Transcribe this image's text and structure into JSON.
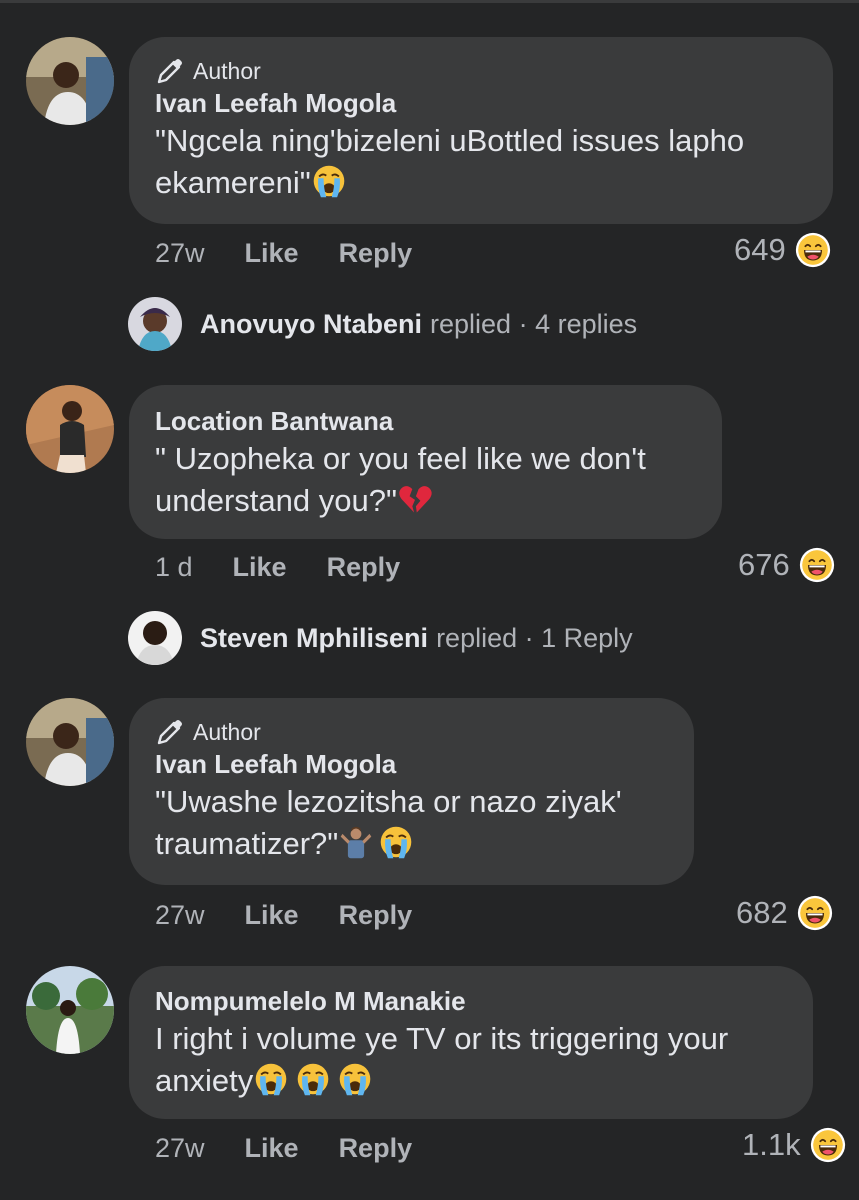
{
  "comments": [
    {
      "is_author": true,
      "author_badge": "Author",
      "name": "Ivan Leefah Mogola",
      "text_lines": [
        "\"Ngcela ning'bizeleni uBottled issues lapho",
        "ekamereni\""
      ],
      "emoji_after": [
        "loudly-crying-face"
      ],
      "time": "27w",
      "like_label": "Like",
      "reply_label": "Reply",
      "reaction_count": "649",
      "reaction_icon": "laughing-face-icon"
    },
    {
      "is_author": false,
      "name": "Location Bantwana",
      "text_lines": [
        "\" Uzopheka or you feel like we don't",
        "understand you?\""
      ],
      "emoji_after": [
        "broken-heart"
      ],
      "time": "1 d",
      "like_label": "Like",
      "reply_label": "Reply",
      "reaction_count": "676",
      "reaction_icon": "laughing-face-icon"
    },
    {
      "is_author": true,
      "author_badge": "Author",
      "name": "Ivan Leefah Mogola",
      "text_lines": [
        "\"Uwashe lezozitsha or nazo ziyak'",
        "traumatizer?\""
      ],
      "emoji_after": [
        "person-shrugging",
        "loudly-crying-face"
      ],
      "time": "27w",
      "like_label": "Like",
      "reply_label": "Reply",
      "reaction_count": "682",
      "reaction_icon": "laughing-face-icon"
    },
    {
      "is_author": false,
      "name": "Nompumelelo M Manakie",
      "text_lines": [
        "I right i volume ye TV or its triggering your",
        "anxiety"
      ],
      "emoji_after": [
        "loudly-crying-face",
        "loudly-crying-face",
        "loudly-crying-face"
      ],
      "time": "27w",
      "like_label": "Like",
      "reply_label": "Reply",
      "reaction_count": "1.1k",
      "reaction_icon": "laughing-face-icon"
    }
  ],
  "reply_threads": [
    {
      "name": "Anovuyo Ntabeni",
      "replied_label": "replied",
      "count_label": "· 4 replies"
    },
    {
      "name": "Steven Mphiliseni",
      "replied_label": "replied",
      "count_label": "· 1 Reply"
    }
  ],
  "colors": {
    "background": "#242526",
    "bubble": "#3a3b3c",
    "primary_text": "#e4e6eb",
    "secondary_text": "#b0b3b8"
  }
}
